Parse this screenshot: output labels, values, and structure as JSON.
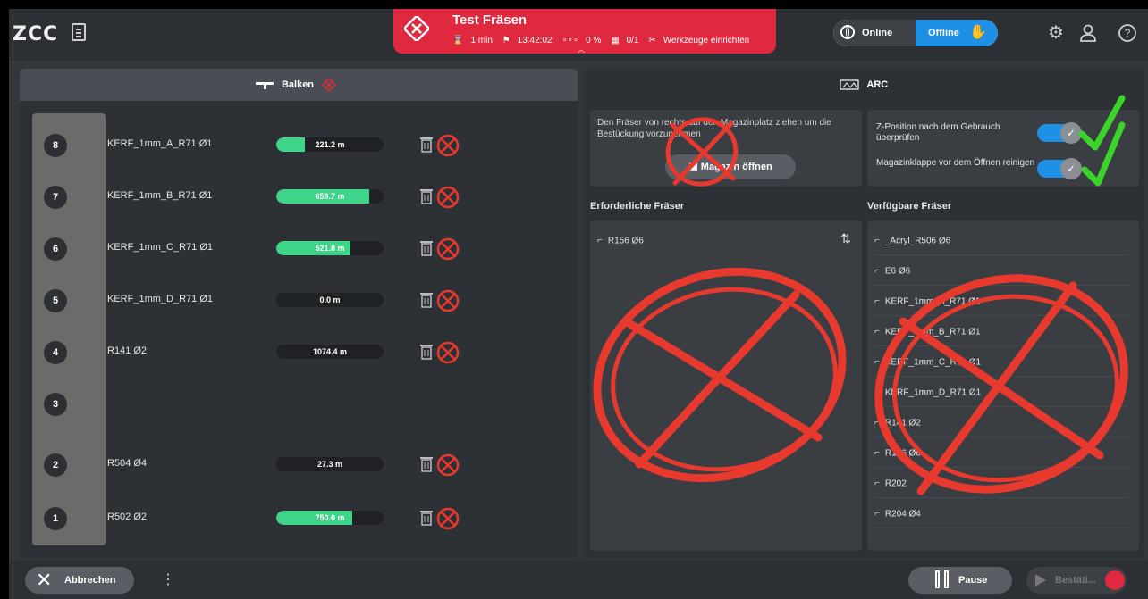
{
  "app": {
    "logo": "ZCC"
  },
  "job": {
    "title": "Test Fräsen",
    "duration": "1 min",
    "time": "13:42:02",
    "progress": "0 %",
    "count": "0/1",
    "action": "Werkzeuge einrichten"
  },
  "mode": {
    "online": "Online",
    "offline": "Offline",
    "selected": "Offline"
  },
  "tabs": {
    "balken": "Balken",
    "arc": "ARC"
  },
  "slots": [
    {
      "num": "8",
      "name": "KERF_1mm_A_R71 Ø1",
      "value": "221.2 m",
      "fill": 0.27
    },
    {
      "num": "7",
      "name": "KERF_1mm_B_R71 Ø1",
      "value": "659.7 m",
      "fill": 0.87
    },
    {
      "num": "6",
      "name": "KERF_1mm_C_R71 Ø1",
      "value": "521.8 m",
      "fill": 0.69
    },
    {
      "num": "5",
      "name": "KERF_1mm_D_R71 Ø1",
      "value": "0.0 m",
      "fill": 0
    },
    {
      "num": "4",
      "name": "R141 Ø2",
      "value": "1074.4 m",
      "fill": 0
    },
    {
      "num": "3",
      "name": "",
      "value": "",
      "fill": 0
    },
    {
      "num": "2",
      "name": "R504 Ø4",
      "value": "27.3 m",
      "fill": 0
    },
    {
      "num": "1",
      "name": "R502 Ø2",
      "value": "750.0 m",
      "fill": 0.71
    }
  ],
  "magazine": {
    "instruction": "Den Fräser von rechts auf den Magazinplatz ziehen um die Bestückung vorzunehmen",
    "open_button": "Magazin öffnen"
  },
  "options": [
    {
      "label": "Z-Position nach dem Gebrauch überprüfen",
      "checked": true
    },
    {
      "label": "Magazinklappe vor dem Öffnen reinigen",
      "checked": true
    }
  ],
  "required": {
    "heading": "Erforderliche Fräser",
    "items": [
      "R156 Ø6"
    ]
  },
  "available": {
    "heading": "Verfügbare Fräser",
    "items": [
      "_Acryl_R506 Ø6",
      "E6 Ø6",
      "KERF_1mm_A_R71 Ø1",
      "KERF_1mm_B_R71 Ø1",
      "KERF_1mm_C_R71 Ø1",
      "KERF_1mm_D_R71 Ø1",
      "R141 Ø2",
      "R156 Ø6",
      "R202",
      "R204 Ø4"
    ]
  },
  "footer": {
    "cancel": "Abbrechen",
    "pause": "Pause",
    "confirm": "Bestäti..."
  },
  "colors": {
    "accent_red": "#e0283e",
    "accent_blue": "#1e90e6",
    "bar_green": "#3ed48a",
    "annotation_red": "#e8392f",
    "annotation_green": "#3bd42a"
  }
}
